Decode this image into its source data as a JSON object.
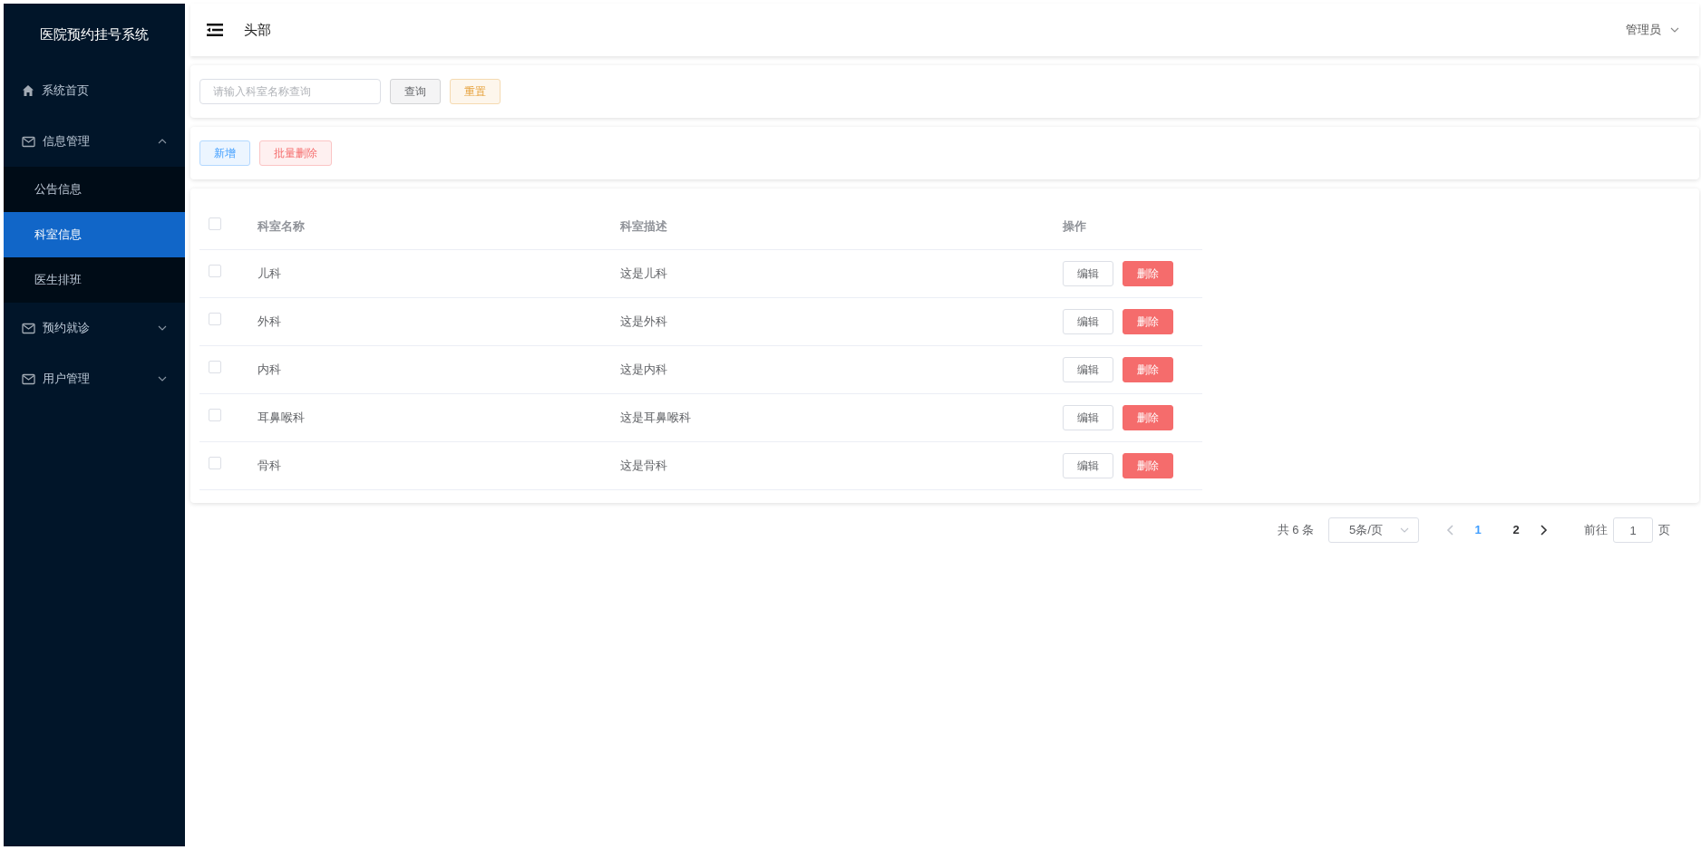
{
  "sidebar": {
    "title": "医院预约挂号系统",
    "items": [
      {
        "kind": "link",
        "label": "系统首页",
        "selected": false
      },
      {
        "kind": "group",
        "label": "信息管理",
        "expanded": true,
        "children": [
          {
            "label": "公告信息",
            "selected": false
          },
          {
            "label": "科室信息",
            "selected": true
          },
          {
            "label": "医生排班",
            "selected": false
          }
        ]
      },
      {
        "kind": "group",
        "label": "预约就诊",
        "expanded": false
      },
      {
        "kind": "group",
        "label": "用户管理",
        "expanded": false
      }
    ]
  },
  "header": {
    "title": "头部",
    "user": "管理员"
  },
  "search": {
    "placeholder": "请输入科室名称查询",
    "buttons": [
      {
        "kind": "plain",
        "label": "查询"
      },
      {
        "kind": "warning",
        "label": "重置"
      }
    ]
  },
  "actions": [
    {
      "kind": "primary",
      "label": "新增"
    },
    {
      "kind": "danger",
      "label": "批量删除"
    }
  ],
  "table": {
    "columns": [
      "科室名称",
      "科室描述",
      "操作"
    ],
    "rows": [
      {
        "checked": false,
        "name": "儿科",
        "description": "这是儿科",
        "edit": "编辑",
        "delete": "删除"
      },
      {
        "checked": false,
        "name": "外科",
        "description": "这是外科",
        "edit": "编辑",
        "delete": "删除"
      },
      {
        "checked": false,
        "name": "内科",
        "description": "这是内科",
        "edit": "编辑",
        "delete": "删除"
      },
      {
        "checked": false,
        "name": "耳鼻喉科",
        "description": "这是耳鼻喉科",
        "edit": "编辑",
        "delete": "删除"
      },
      {
        "checked": false,
        "name": "骨科",
        "description": "这是骨科",
        "edit": "编辑",
        "delete": "删除"
      }
    ],
    "all_checked": false
  },
  "pagination": {
    "total": "共 6 条",
    "page_size": "5条/页",
    "pages": [
      {
        "label": "1",
        "selected": true
      },
      {
        "label": "2",
        "selected": false
      }
    ],
    "goto_label": "前往",
    "goto_value": "1",
    "goto_suffix": "页"
  }
}
